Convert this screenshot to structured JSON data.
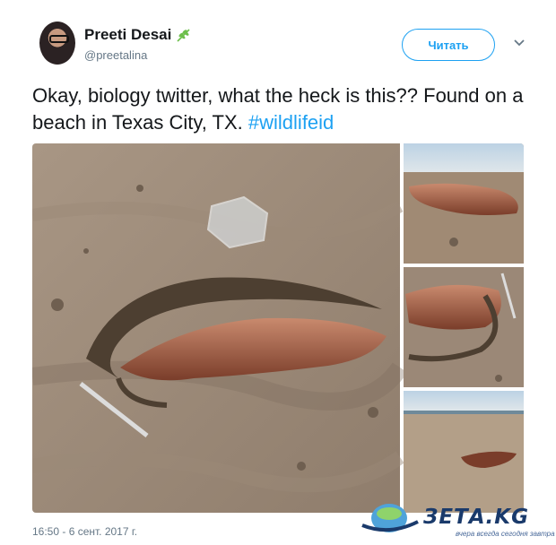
{
  "tweet": {
    "display_name": "Preeti Desai",
    "handle": "@preetalina",
    "follow_label": "Читать",
    "text_main": "Okay, biology twitter, what the heck is this?? Found on a beach in Texas City, TX. ",
    "hashtag": "#wildlifeid",
    "timestamp": "16:50 - 6 сент. 2017 г."
  },
  "icons": {
    "name_badge": "seedling-icon",
    "menu": "chevron-down-icon"
  },
  "watermark": {
    "brand": "ЗЕТА.KG",
    "tagline": "вчера всегда сегодня завтра"
  },
  "colors": {
    "accent": "#1da1f2",
    "leaf": "#6dbf4b",
    "muted": "#657786"
  }
}
